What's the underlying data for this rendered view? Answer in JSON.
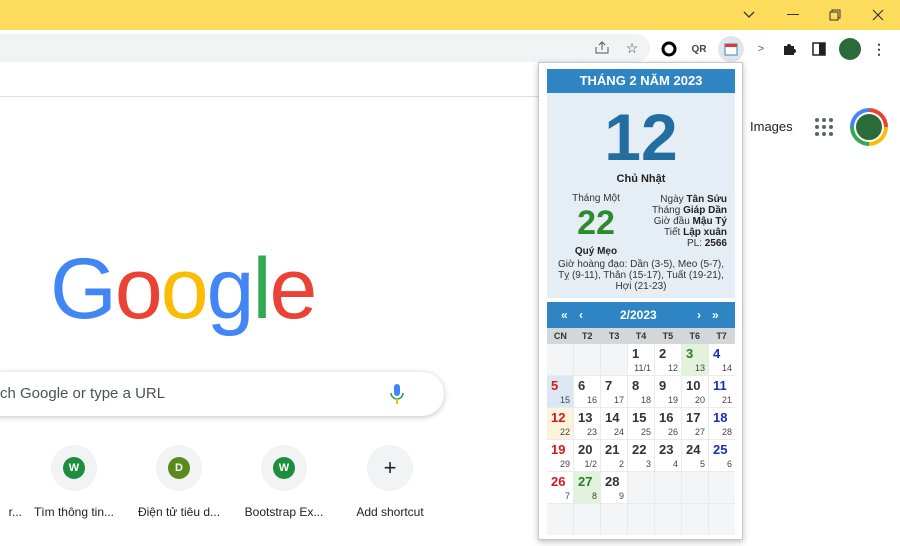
{
  "window": {
    "controls": {
      "dropdown_icon": "chevron-down-icon",
      "minimize_icon": "minimize-icon",
      "maximize_icon": "maximize-icon",
      "close_icon": "close-icon"
    }
  },
  "toolbar": {
    "icons": [
      "share-icon",
      "star-icon",
      "circle-ext-icon",
      "qr-ext-icon",
      "calendar-ext-icon",
      "code-ext-icon",
      "extensions-puzzle-icon",
      "sidepanel-icon",
      "profile-avatar",
      "menu-kebab-icon"
    ]
  },
  "google": {
    "images_label": "Images",
    "logo_letters": [
      "G",
      "o",
      "o",
      "g",
      "l",
      "e"
    ],
    "logo_colors": [
      "#4285f4",
      "#ea4335",
      "#fbbc05",
      "#4285f4",
      "#34a853",
      "#ea4335"
    ],
    "search_placeholder": "ch Google or type a URL",
    "shortcuts": [
      {
        "label": "r...",
        "letter": ""
      },
      {
        "label": "Tìm thông tin...",
        "letter": "W",
        "color": "#1e8e3e"
      },
      {
        "label": "Điện tử tiêu d...",
        "letter": "D",
        "color": "#5a8a1c"
      },
      {
        "label": "Bootstrap Ex...",
        "letter": "W",
        "color": "#1e8e3e"
      },
      {
        "label": "Add shortcut",
        "letter": "+"
      }
    ]
  },
  "calendar": {
    "header": "THÁNG 2 NĂM 2023",
    "solar_day": "12",
    "weekday": "Chủ Nhật",
    "lunar_month_label": "Tháng Một",
    "lunar_day": "22",
    "lunar_year": "Quý Mẹo",
    "details": [
      {
        "label": "Ngày",
        "value": "Tân Sửu"
      },
      {
        "label": "Tháng",
        "value": "Giáp Dần"
      },
      {
        "label": "Giờ đầu",
        "value": "Mậu Tý"
      },
      {
        "label": "Tiết",
        "value": "Lập xuân"
      },
      {
        "label": "PL:",
        "value": "2566"
      }
    ],
    "good_hours": "Giờ hoàng đạo: Dần (3-5), Meo (5-7), Tỵ (9-11), Thân (15-17), Tuất (19-21), Hợi (21-23)",
    "nav": {
      "prev_year": "«",
      "prev_month": "‹",
      "month": "2/2023",
      "next_month": "›",
      "next_year": "»"
    },
    "dow": [
      "CN",
      "T2",
      "T3",
      "T4",
      "T5",
      "T6",
      "T7"
    ],
    "weeks": [
      [
        {
          "s": "",
          "l": ""
        },
        {
          "s": "",
          "l": ""
        },
        {
          "s": "",
          "l": ""
        },
        {
          "s": "1",
          "l": "11/1"
        },
        {
          "s": "2",
          "l": "12"
        },
        {
          "s": "3",
          "l": "13",
          "g": true
        },
        {
          "s": "4",
          "l": "14"
        }
      ],
      [
        {
          "s": "5",
          "l": "15",
          "sel": true
        },
        {
          "s": "6",
          "l": "16"
        },
        {
          "s": "7",
          "l": "17"
        },
        {
          "s": "8",
          "l": "18"
        },
        {
          "s": "9",
          "l": "19"
        },
        {
          "s": "10",
          "l": "20"
        },
        {
          "s": "11",
          "l": "21"
        }
      ],
      [
        {
          "s": "12",
          "l": "22",
          "cur": true
        },
        {
          "s": "13",
          "l": "23"
        },
        {
          "s": "14",
          "l": "24"
        },
        {
          "s": "15",
          "l": "25"
        },
        {
          "s": "16",
          "l": "26"
        },
        {
          "s": "17",
          "l": "27"
        },
        {
          "s": "18",
          "l": "28"
        }
      ],
      [
        {
          "s": "19",
          "l": "29"
        },
        {
          "s": "20",
          "l": "1/2"
        },
        {
          "s": "21",
          "l": "2"
        },
        {
          "s": "22",
          "l": "3"
        },
        {
          "s": "23",
          "l": "4"
        },
        {
          "s": "24",
          "l": "5"
        },
        {
          "s": "25",
          "l": "6"
        }
      ],
      [
        {
          "s": "26",
          "l": "7"
        },
        {
          "s": "27",
          "l": "8",
          "g": true
        },
        {
          "s": "28",
          "l": "9"
        },
        {
          "s": "",
          "l": ""
        },
        {
          "s": "",
          "l": ""
        },
        {
          "s": "",
          "l": ""
        },
        {
          "s": "",
          "l": ""
        }
      ],
      [
        {
          "s": "",
          "l": ""
        },
        {
          "s": "",
          "l": ""
        },
        {
          "s": "",
          "l": ""
        },
        {
          "s": "",
          "l": ""
        },
        {
          "s": "",
          "l": ""
        },
        {
          "s": "",
          "l": ""
        },
        {
          "s": "",
          "l": ""
        }
      ]
    ]
  }
}
